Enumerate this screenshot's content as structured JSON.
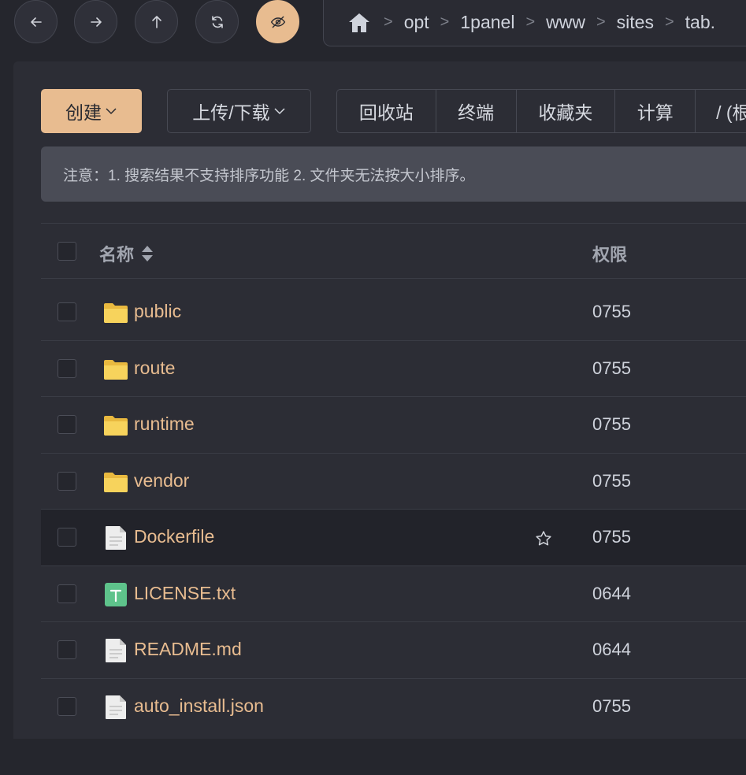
{
  "nav": {
    "icons": [
      "back-arrow-icon",
      "forward-arrow-icon",
      "up-arrow-icon",
      "refresh-icon",
      "eye-off-icon"
    ]
  },
  "breadcrumb": {
    "items": [
      "opt",
      "1panel",
      "www",
      "sites",
      "tab."
    ],
    "separator": ">"
  },
  "toolbar": {
    "create_label": "创建",
    "upload_label": "上传/下载",
    "group": [
      "回收站",
      "终端",
      "收藏夹",
      "计算",
      "/ (根"
    ]
  },
  "notice": {
    "text": "注意：1. 搜索结果不支持排序功能 2. 文件夹无法按大小排序。"
  },
  "table": {
    "headers": {
      "name": "名称",
      "permission": "权限"
    },
    "rows": [
      {
        "name": "public",
        "type": "folder",
        "permission": "0755"
      },
      {
        "name": "route",
        "type": "folder",
        "permission": "0755"
      },
      {
        "name": "runtime",
        "type": "folder",
        "permission": "0755"
      },
      {
        "name": "vendor",
        "type": "folder",
        "permission": "0755"
      },
      {
        "name": "Dockerfile",
        "type": "file",
        "permission": "0755",
        "hover": true
      },
      {
        "name": "LICENSE.txt",
        "type": "text",
        "permission": "0644"
      },
      {
        "name": "README.md",
        "type": "file",
        "permission": "0644"
      },
      {
        "name": "auto_install.json",
        "type": "file",
        "permission": "0755"
      }
    ]
  },
  "colors": {
    "accent": "#e8bc90",
    "background": "#25262d",
    "panel": "#2c2d35",
    "folder": "#f7d35c",
    "text_icon": "#5ec38b"
  }
}
